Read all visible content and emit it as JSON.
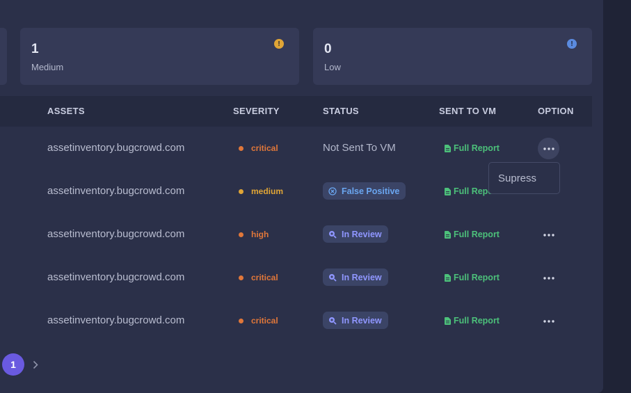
{
  "summary_cards": [
    {
      "count": "1",
      "label": "Medium",
      "badge": "!",
      "color": "#e0a536"
    },
    {
      "count": "0",
      "label": "Low",
      "badge": "!",
      "color": "#5b8be0"
    }
  ],
  "table": {
    "columns": [
      "ASSETS",
      "SEVERITY",
      "STATUS",
      "SENT TO VM",
      "OPTION"
    ],
    "rows": [
      {
        "asset": "assetinventory.bugcrowd.com",
        "severity": "critical",
        "status": "Not Sent To VM",
        "status_type": "plain",
        "report": "Full Report"
      },
      {
        "asset": "assetinventory.bugcrowd.com",
        "severity": "medium",
        "status": "False Positive",
        "status_type": "false-positive",
        "report": "Full Report"
      },
      {
        "asset": "assetinventory.bugcrowd.com",
        "severity": "high",
        "status": "In Review",
        "status_type": "in-review",
        "report": "Full Report"
      },
      {
        "asset": "assetinventory.bugcrowd.com",
        "severity": "critical",
        "status": "In Review",
        "status_type": "in-review",
        "report": "Full Report"
      },
      {
        "asset": "assetinventory.bugcrowd.com",
        "severity": "critical",
        "status": "In Review",
        "status_type": "in-review",
        "report": "Full Report"
      }
    ]
  },
  "option_menu": {
    "item": "Supress"
  },
  "pagination": {
    "current_page": "1"
  },
  "colors": {
    "critical": "#e0773a",
    "high": "#e0773a",
    "medium": "#e0a536",
    "false_positive": "#6aa6f0",
    "in_review": "#8f96ff",
    "report": "#4cc07a",
    "accent": "#6a5ae0"
  }
}
